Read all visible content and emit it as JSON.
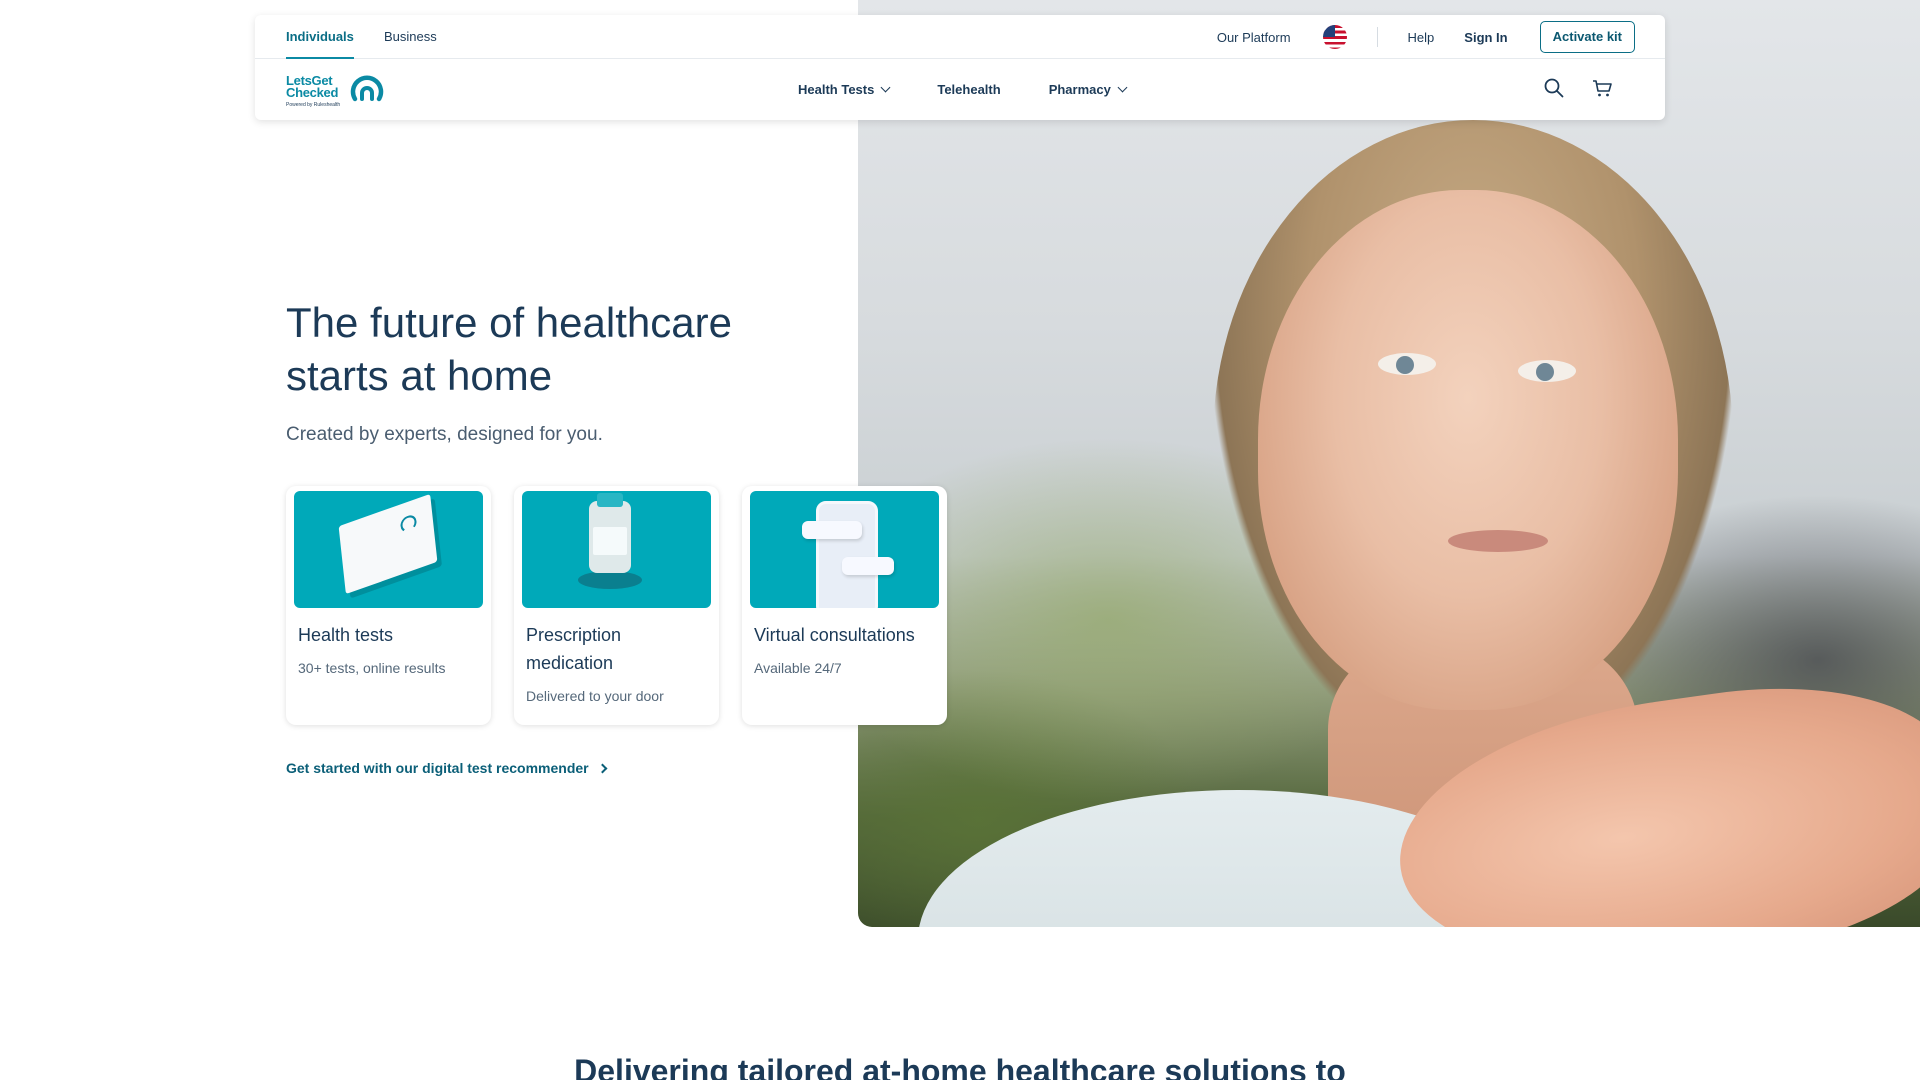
{
  "header": {
    "audience_tabs": [
      {
        "label": "Individuals",
        "active": true
      },
      {
        "label": "Business",
        "active": false
      }
    ],
    "utility_links": {
      "our_platform": "Our Platform",
      "help": "Help",
      "sign_in": "Sign In",
      "activate_kit": "Activate kit"
    },
    "flag_icon": "us-flag-icon",
    "logo": {
      "line1": "LetsGet",
      "line2": "Checked",
      "sub": "Powered by Ruleshealth"
    },
    "nav": [
      {
        "label": "Health Tests",
        "has_dropdown": true
      },
      {
        "label": "Telehealth",
        "has_dropdown": false
      },
      {
        "label": "Pharmacy",
        "has_dropdown": true
      }
    ],
    "icons": [
      "search-icon",
      "cart-icon"
    ]
  },
  "hero": {
    "title": "The future of healthcare starts at home",
    "subtitle": "Created by experts, designed for you.",
    "cards": [
      {
        "title": "Health tests",
        "desc": "30+ tests, online results"
      },
      {
        "title": "Prescription medication",
        "desc": "Delivered to your door"
      },
      {
        "title": "Virtual consultations",
        "desc": "Available 24/7"
      }
    ],
    "cta": "Get started with our digital test recommender"
  },
  "section": {
    "heading": "Delivering tailored at-home healthcare solutions to"
  },
  "colors": {
    "brand_teal": "#0b8aa4",
    "card_teal": "#00a9b9",
    "navy_text": "#1c3a57"
  }
}
